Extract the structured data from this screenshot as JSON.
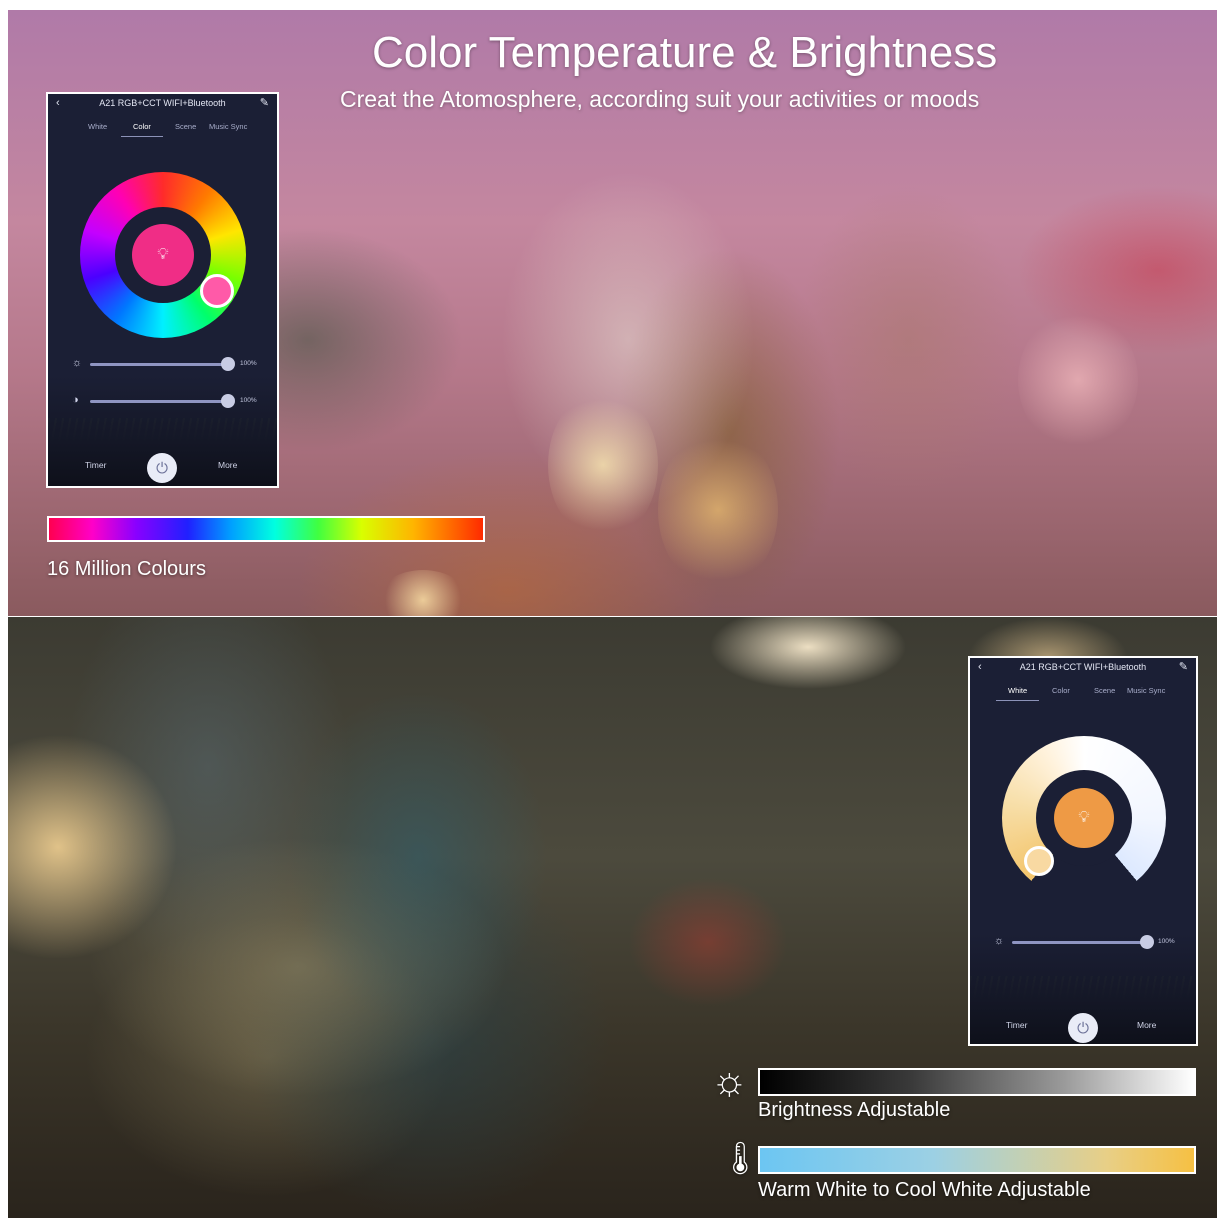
{
  "headline": {
    "title": "Color Temperature & Brightness",
    "subtitle": "Creat the Atomosphere, according suit your activities or moods"
  },
  "panel_color": {
    "app_title": "A21 RGB+CCT WIFI+Bluetooth",
    "tabs": [
      "White",
      "Color",
      "Scene",
      "Music Sync"
    ],
    "active_tab": "Color",
    "sliders": [
      {
        "icon": "sun-icon",
        "value": "100%",
        "level": 1.0
      },
      {
        "icon": "contrast-icon",
        "value": "100%",
        "level": 1.0
      }
    ],
    "timer_label": "Timer",
    "more_label": "More",
    "selected_color": "#f02d86"
  },
  "panel_white": {
    "app_title": "A21 RGB+CCT WIFI+Bluetooth",
    "tabs": [
      "White",
      "Color",
      "Scene",
      "Music Sync"
    ],
    "active_tab": "White",
    "sliders": [
      {
        "icon": "sun-icon",
        "value": "100%",
        "level": 1.0
      }
    ],
    "timer_label": "Timer",
    "more_label": "More",
    "selected_color": "#ee9a45"
  },
  "captions": {
    "colors": "16 Million Colours",
    "brightness": "Brightness Adjustable",
    "temperature": "Warm White to Cool White Adjustable"
  }
}
